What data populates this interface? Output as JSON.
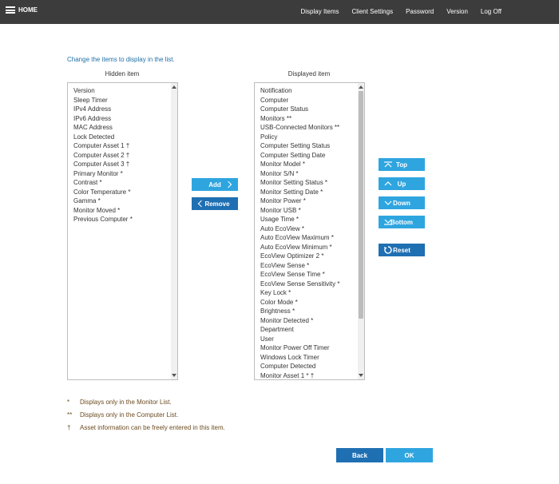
{
  "header": {
    "home_label": "HOME",
    "nav": [
      "Display Items",
      "Client Settings",
      "Password",
      "Version",
      "Log Off"
    ]
  },
  "instruction": "Change the items to display in the list.",
  "hidden": {
    "title": "Hidden item",
    "items": [
      "Version",
      "Sleep Timer",
      "IPv4 Address",
      "IPv6 Address",
      "MAC Address",
      "Lock Detected",
      "Computer Asset 1 †",
      "Computer Asset 2 †",
      "Computer Asset 3 †",
      "Primary Monitor *",
      "Contrast *",
      "Color Temperature *",
      "Gamma *",
      "Monitor Moved *",
      "Previous Computer *"
    ]
  },
  "displayed": {
    "title": "Displayed item",
    "items": [
      "Notification",
      "Computer",
      "Computer Status",
      "Monitors **",
      "USB-Connected Monitors **",
      "Policy",
      "Computer Setting Status",
      "Computer Setting Date",
      "Monitor Model *",
      "Monitor S/N *",
      "Monitor Setting Status *",
      "Monitor Setting Date *",
      "Monitor Power *",
      "Monitor USB *",
      "Usage Time *",
      "Auto EcoView *",
      "Auto EcoView Maximum *",
      "Auto EcoView Minimum *",
      "EcoView Optimizer 2 *",
      "EcoView Sense *",
      "EcoView Sense Time *",
      "EcoView Sense Sensitivity *",
      "Key Lock *",
      "Color Mode *",
      "Brightness *",
      "Monitor Detected *",
      "Department",
      "User",
      "Monitor Power Off Timer",
      "Windows Lock Timer",
      "Computer Detected",
      "Monitor Asset 1 * †"
    ]
  },
  "buttons": {
    "add": "Add",
    "remove": "Remove",
    "top": "Top",
    "up": "Up",
    "down": "Down",
    "bottom": "Bottom",
    "reset": "Reset",
    "back": "Back",
    "ok": "OK"
  },
  "notes": [
    {
      "mark": "*",
      "text": "Displays only in the Monitor List."
    },
    {
      "mark": "**",
      "text": "Displays only in the Computer List."
    },
    {
      "mark": "†",
      "text": "Asset information can be freely entered in this item."
    }
  ],
  "colors": {
    "header_bg": "#3c3c3c",
    "primary_button": "#2fa5e0",
    "secondary_button": "#1f6fb3",
    "instruction_text": "#1f6fa6",
    "note_text": "#6b4b1f"
  },
  "icons": [
    "menu-icon",
    "chevron-right-icon",
    "chevron-left-icon",
    "move-top-icon",
    "move-up-icon",
    "move-down-icon",
    "move-bottom-icon",
    "reset-icon"
  ]
}
